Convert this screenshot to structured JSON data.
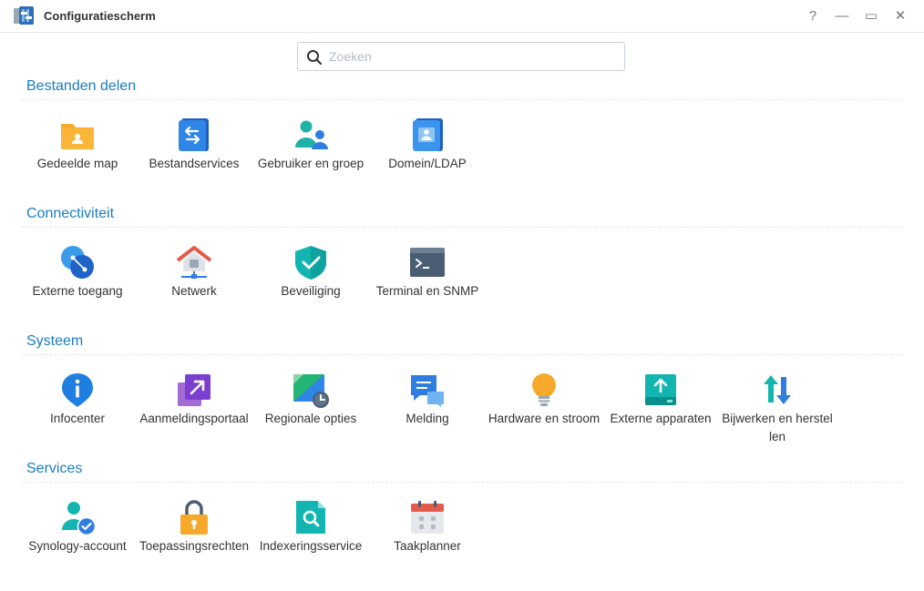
{
  "window": {
    "title": "Configuratiescherm",
    "buttons": {
      "help": "?",
      "minimize": "—",
      "maximize": "▭",
      "close": "✕"
    }
  },
  "search": {
    "placeholder": "Zoeken",
    "value": ""
  },
  "sections": [
    {
      "title": "Bestanden delen",
      "items": [
        {
          "label": "Gedeelde map",
          "icon": "shared-folder-icon"
        },
        {
          "label": "Bestandservices",
          "icon": "file-services-icon"
        },
        {
          "label": "Gebruiker en groep",
          "icon": "user-group-icon"
        },
        {
          "label": "Domein/LDAP",
          "icon": "domain-ldap-icon"
        }
      ]
    },
    {
      "title": "Connectiviteit",
      "items": [
        {
          "label": "Externe toegang",
          "icon": "external-access-icon"
        },
        {
          "label": "Netwerk",
          "icon": "network-icon"
        },
        {
          "label": "Beveiliging",
          "icon": "security-shield-icon"
        },
        {
          "label": "Terminal en SNMP",
          "icon": "terminal-icon"
        }
      ]
    },
    {
      "title": "Systeem",
      "items": [
        {
          "label": "Infocenter",
          "icon": "info-center-icon"
        },
        {
          "label": "Aanmeldingsportaal",
          "icon": "login-portal-icon"
        },
        {
          "label": "Regionale opties",
          "icon": "regional-options-icon"
        },
        {
          "label": "Melding",
          "icon": "notification-icon"
        },
        {
          "label": "Hardware en stroom",
          "icon": "hardware-power-icon"
        },
        {
          "label": "Externe apparaten",
          "icon": "external-devices-icon"
        },
        {
          "label": "Bijwerken en herstellen",
          "icon": "update-restore-icon"
        }
      ]
    },
    {
      "title": "Services",
      "items": [
        {
          "label": "Synology-account",
          "icon": "synology-account-icon"
        },
        {
          "label": "Toepassingsrechten",
          "icon": "application-privileges-icon"
        },
        {
          "label": "Indexeringsservice",
          "icon": "indexing-service-icon"
        },
        {
          "label": "Taakplanner",
          "icon": "task-scheduler-icon"
        }
      ]
    }
  ],
  "colors": {
    "section_title": "#1a7cc0",
    "text": "#333333"
  }
}
